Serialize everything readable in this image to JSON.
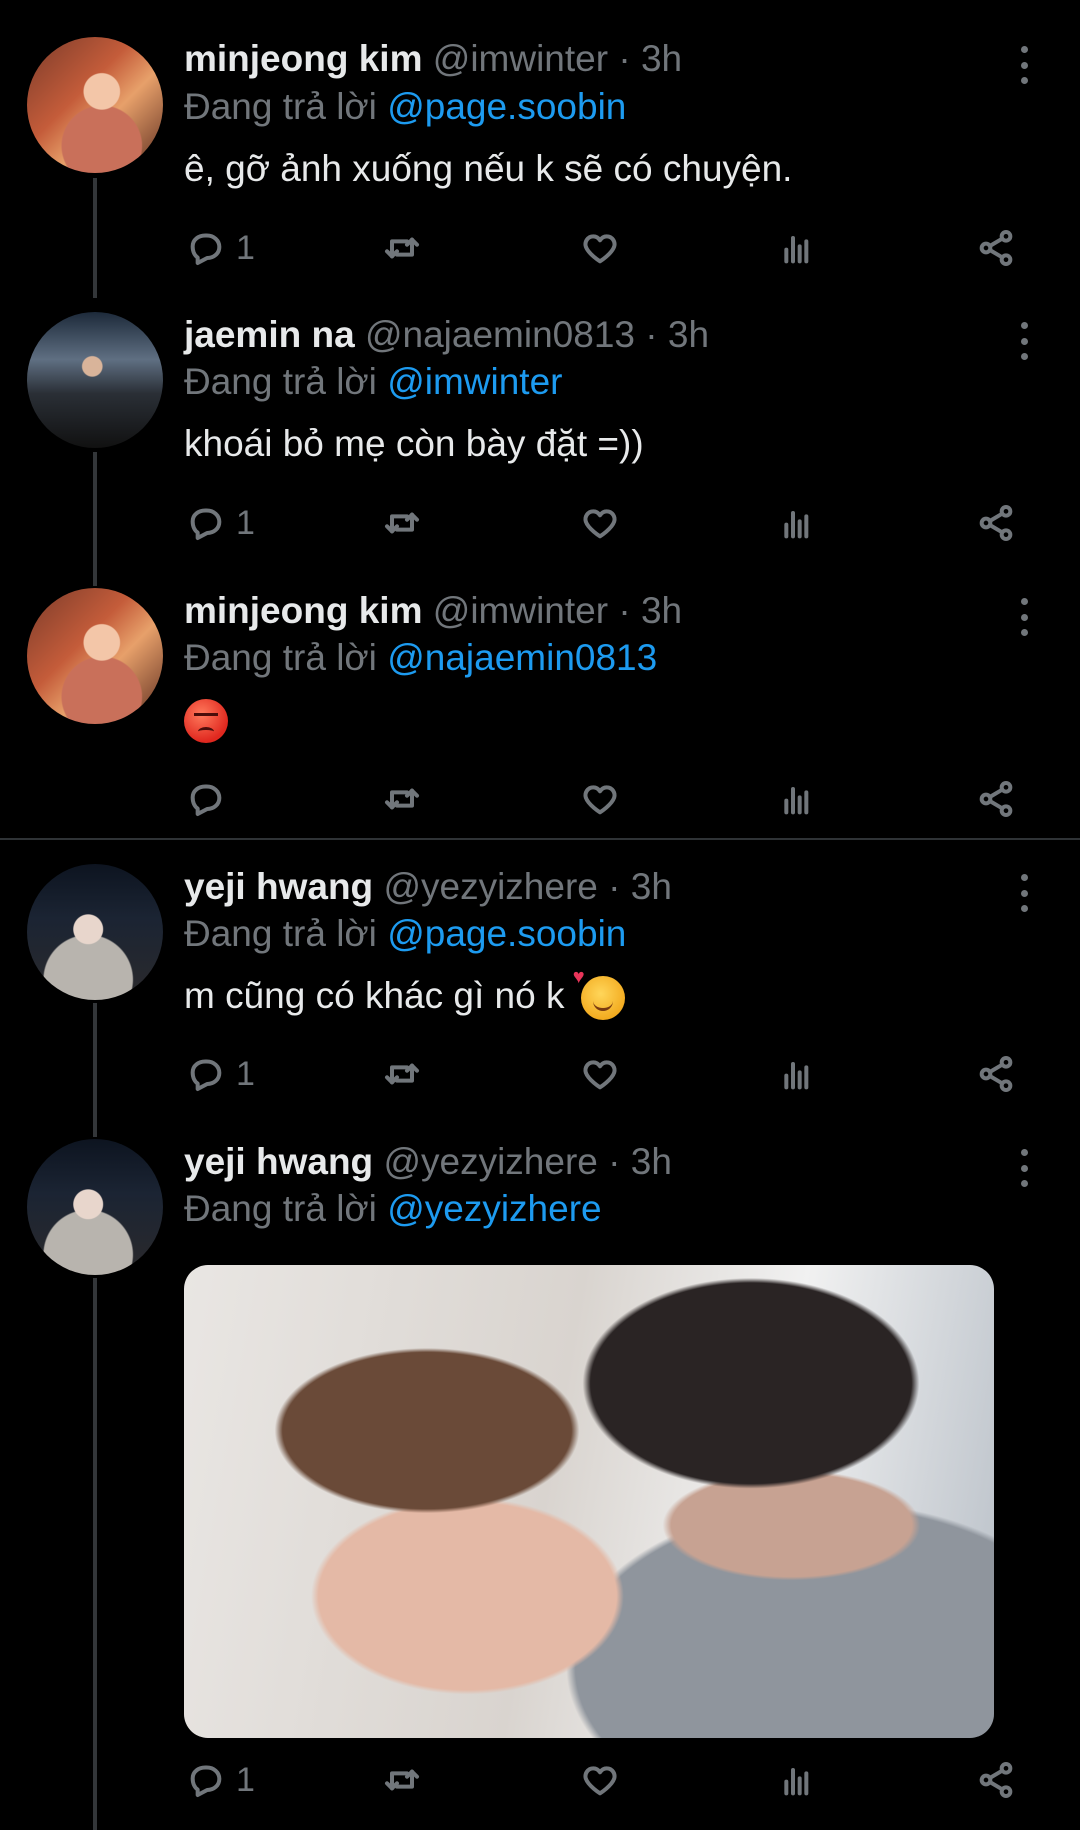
{
  "colors": {
    "background": "#000000",
    "mention": "#1d9bf0",
    "muted": "#71767b",
    "text": "#e7e9ea"
  },
  "reply_prefix": "Đang trả lời",
  "tweets": [
    {
      "name": "minjeong kim",
      "handle": "@imwinter",
      "time": "· 3h",
      "reply_to": "@page.soobin",
      "text": "ê, gỡ ảnh xuống nếu k sẽ có chuyện.",
      "reply_count": "1"
    },
    {
      "name": "jaemin na",
      "handle": "@najaemin0813",
      "time": "· 3h",
      "reply_to": "@imwinter",
      "text": "khoái bỏ mẹ còn bày đặt =))",
      "reply_count": "1"
    },
    {
      "name": "minjeong kim",
      "handle": "@imwinter",
      "time": "· 3h",
      "reply_to": "@najaemin0813",
      "emoji": "angry-face",
      "reply_count": ""
    },
    {
      "name": "yeji hwang",
      "handle": "@yezyizhere",
      "time": "· 3h",
      "reply_to": "@page.soobin",
      "text": "m cũng có khác gì nó k",
      "emoji": "smiling-face-with-hearts",
      "reply_count": "1"
    },
    {
      "name": "yeji hwang",
      "handle": "@yezyizhere",
      "time": "· 3h",
      "reply_to": "@yezyizhere",
      "media": "photo",
      "reply_count": "1"
    }
  ]
}
